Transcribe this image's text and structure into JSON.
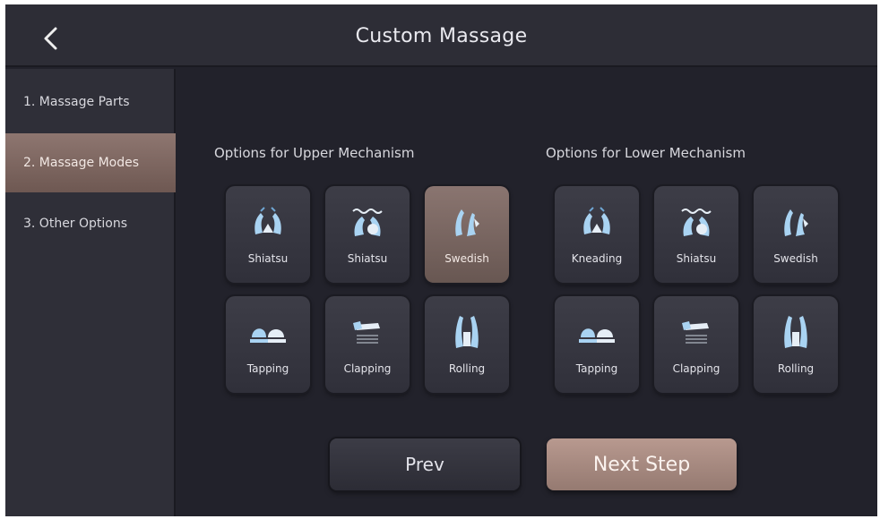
{
  "header": {
    "title": "Custom Massage",
    "back_icon": "chevron-left-icon"
  },
  "sidebar": {
    "items": [
      {
        "label": "1. Massage Parts",
        "active": false
      },
      {
        "label": "2. Massage Modes",
        "active": true
      },
      {
        "label": "3. Other Options",
        "active": false
      }
    ]
  },
  "upper": {
    "heading": "Options for Upper Mechanism",
    "modes": [
      {
        "label": "Shiatsu",
        "icon": "shiatsu-hands-icon",
        "selected": false
      },
      {
        "label": "Shiatsu",
        "icon": "shiatsu-wave-hands-icon",
        "selected": false
      },
      {
        "label": "Swedish",
        "icon": "swedish-hands-icon",
        "selected": true
      },
      {
        "label": "Tapping",
        "icon": "tapping-hands-icon",
        "selected": false
      },
      {
        "label": "Clapping",
        "icon": "clapping-hands-icon",
        "selected": false
      },
      {
        "label": "Rolling",
        "icon": "rolling-hands-icon",
        "selected": false
      }
    ]
  },
  "lower": {
    "heading": "Options for Lower Mechanism",
    "modes": [
      {
        "label": "Kneading",
        "icon": "kneading-hands-icon",
        "selected": false
      },
      {
        "label": "Shiatsu",
        "icon": "shiatsu-wave-hands-icon",
        "selected": false
      },
      {
        "label": "Swedish",
        "icon": "swedish-hands-icon",
        "selected": false
      },
      {
        "label": "Tapping",
        "icon": "tapping-hands-icon",
        "selected": false
      },
      {
        "label": "Clapping",
        "icon": "clapping-hands-icon",
        "selected": false
      },
      {
        "label": "Rolling",
        "icon": "rolling-hands-icon",
        "selected": false
      }
    ]
  },
  "footer": {
    "prev_label": "Prev",
    "next_label": "Next Step"
  },
  "colors": {
    "background": "#22222b",
    "accent": "#957a71",
    "icon_blue": "#a9d3f2"
  }
}
